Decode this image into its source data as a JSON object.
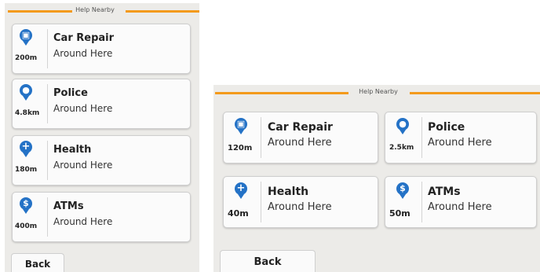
{
  "colors": {
    "accent_bar": "#f39a1c",
    "pin": "#2472c6",
    "screen_bg": "#ecebe8",
    "card_bg": "#fbfbfb"
  },
  "portrait": {
    "header": {
      "title": "Help Nearby"
    },
    "cards": [
      {
        "icon": "car-repair-icon",
        "distance": "200m",
        "name": "Car Repair",
        "subtitle": "Around Here"
      },
      {
        "icon": "police-icon",
        "distance": "4.8km",
        "name": "Police",
        "subtitle": "Around Here"
      },
      {
        "icon": "health-icon",
        "distance": "180m",
        "name": "Health",
        "subtitle": "Around Here"
      },
      {
        "icon": "atm-icon",
        "distance": "400m",
        "name": "ATMs",
        "subtitle": "Around Here"
      }
    ],
    "back_label": "Back"
  },
  "landscape": {
    "header": {
      "title": "Help Nearby"
    },
    "cards": [
      {
        "icon": "car-repair-icon",
        "distance": "120m",
        "name": "Car Repair",
        "subtitle": "Around Here"
      },
      {
        "icon": "police-icon",
        "distance": "2.5km",
        "name": "Police",
        "subtitle": "Around Here"
      },
      {
        "icon": "health-icon",
        "distance": "40m",
        "name": "Health",
        "subtitle": "Around Here"
      },
      {
        "icon": "atm-icon",
        "distance": "50m",
        "name": "ATMs",
        "subtitle": "Around Here"
      }
    ],
    "back_label": "Back"
  }
}
